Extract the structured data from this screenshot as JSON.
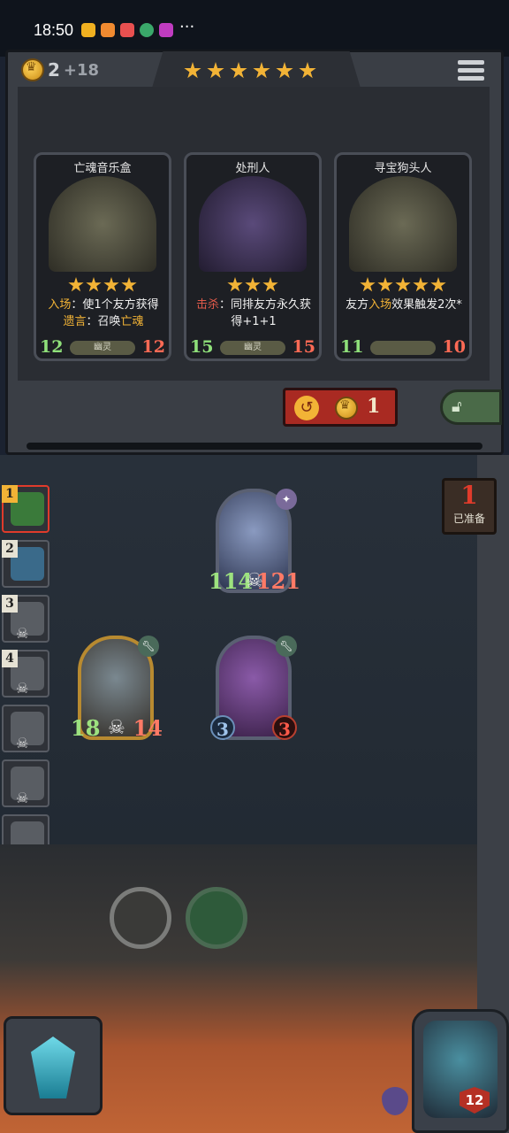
{
  "status_bar": {
    "time": "18:50",
    "more": "···"
  },
  "shop": {
    "gold": "2",
    "income": "+18",
    "tavern_stars": 6,
    "cards": [
      {
        "name": "亡魂音乐盒",
        "stars": 4,
        "text_parts": [
          "入场",
          "：使1个友方获得",
          "遗言",
          "：召唤",
          "亡魂"
        ],
        "attack": "12",
        "health": "12",
        "tribe": "幽灵"
      },
      {
        "name": "处刑人",
        "stars": 3,
        "text_parts": [
          "击杀",
          "：同排友方永久获得+1+1"
        ],
        "attack": "15",
        "health": "15",
        "tribe": "幽灵"
      },
      {
        "name": "寻宝狗头人",
        "stars": 5,
        "text_parts": [
          "友方",
          "入场",
          "效果触发2次*"
        ],
        "attack": "11",
        "health": "10",
        "tribe": ""
      }
    ],
    "refresh_cost": "1"
  },
  "ready": {
    "count": "1",
    "label": "已准备"
  },
  "roster": [
    {
      "rank": "1"
    },
    {
      "rank": "2"
    },
    {
      "rank": "3"
    },
    {
      "rank": "4"
    },
    {
      "rank": ""
    },
    {
      "rank": ""
    },
    {
      "rank": ""
    },
    {
      "rank": ""
    }
  ],
  "board": {
    "minions": [
      {
        "name": "wizard",
        "attack": "114",
        "health": "121"
      },
      {
        "name": "robot",
        "attack": "18",
        "health": "14"
      },
      {
        "name": "rocket",
        "attack": "3",
        "health": "3"
      }
    ]
  },
  "hero": {
    "health": "12"
  },
  "colors": {
    "gold": "#f2b336",
    "attack": "#8fe07a",
    "health": "#ff6a55",
    "refresh": "#a92a22"
  }
}
